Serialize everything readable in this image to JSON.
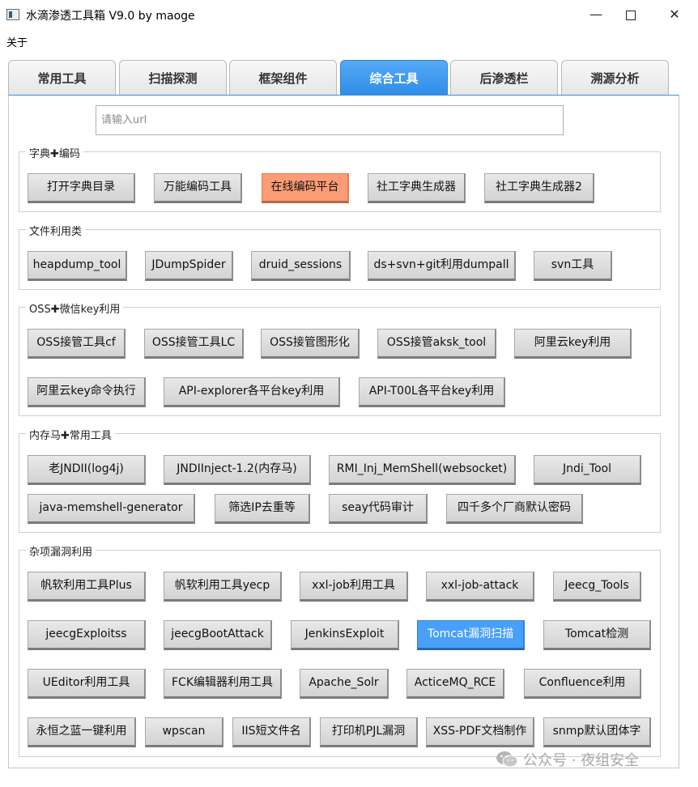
{
  "window": {
    "title": "水滴渗透工具箱 V9.0 by maoge",
    "min": "—",
    "close": "✕"
  },
  "menu": {
    "about": "关于"
  },
  "tabs": [
    "常用工具",
    "扫描探测",
    "框架组件",
    "综合工具",
    "后渗透栏",
    "溯源分析"
  ],
  "active_tab": "综合工具",
  "url_input": {
    "placeholder": "请输入url",
    "value": ""
  },
  "groups": [
    {
      "title": "字典✚编码",
      "buttons": [
        "打开字典目录",
        "万能编码工具",
        "在线编码平台",
        "社工字典生成器",
        "社工字典生成器2"
      ]
    },
    {
      "title": "文件利用类",
      "buttons": [
        "heapdump_tool",
        "JDumpSpider",
        "druid_sessions",
        "ds+svn+git利用dumpall",
        "svn工具"
      ]
    },
    {
      "title": "OSS✚微信key利用",
      "buttons": [
        "OSS接管工具cf",
        "OSS接管工具LC",
        "OSS接管图形化",
        "OSS接管aksk_tool",
        "阿里云key利用",
        "阿里云key命令执行",
        "API-explorer各平台key利用",
        "API-T00L各平台key利用"
      ]
    },
    {
      "title": "内存马✚常用工具",
      "buttons": [
        "老JNDII(log4j)",
        "JNDIInject-1.2(内存马)",
        "RMI_Inj_MemShell(websocket)",
        "Jndi_Tool",
        "java-memshell-generator",
        "筛选IP去重等",
        "seay代码审计",
        "四千多个厂商默认密码"
      ]
    },
    {
      "title": "杂项漏洞利用",
      "buttons": [
        "帆软利用工具Plus",
        "帆软利用工具yecp",
        "xxl-job利用工具",
        "xxl-job-attack",
        "Jeecg_Tools",
        "jeecgExploitss",
        "jeecgBootAttack",
        "JenkinsExploit",
        "Tomcat漏洞扫描",
        "Tomcat检测",
        "UEditor利用工具",
        "FCK编辑器利用工具",
        "Apache_Solr",
        "ActiceMQ_RCE",
        "Confluence利用",
        "永恒之蓝一键利用",
        "wpscan",
        "IIS短文件名",
        "打印机PJL漏洞",
        "XSS-PDF文档制作",
        "snmp默认团体字"
      ]
    }
  ],
  "highlighted_buttons": {
    "orange": "在线编码平台",
    "blue": "Tomcat漏洞扫描"
  },
  "colors": {
    "tab_active": "#3b95ec",
    "button_orange": "#fc9c74",
    "button_blue": "#49a0fa"
  },
  "watermark": {
    "icon": "wechat-icon",
    "text": "公众号 · 夜组安全"
  }
}
